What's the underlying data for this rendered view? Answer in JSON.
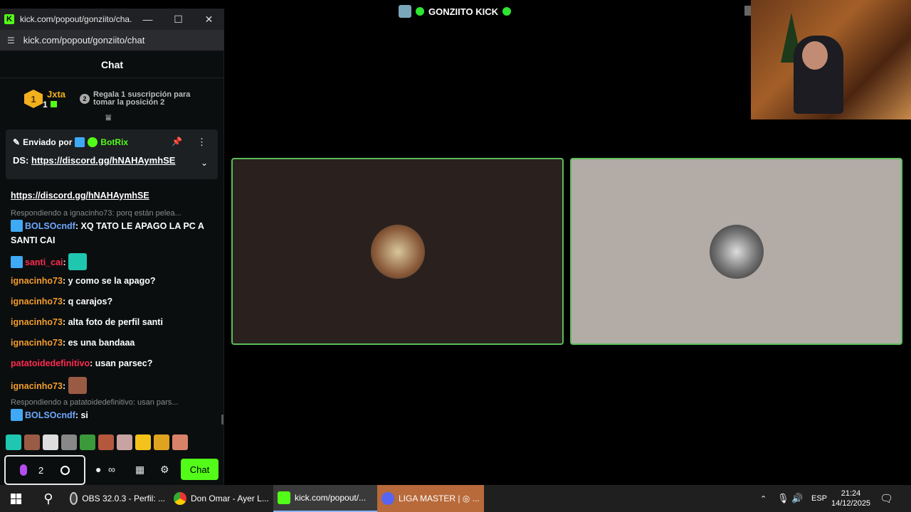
{
  "window": {
    "title": "kick.com/popout/gonziito/cha...",
    "minimize": "—",
    "maximize": "☐",
    "close": "✕",
    "url": "kick.com/popout/gonziito/chat"
  },
  "chat": {
    "header": "Chat",
    "leaderboard": {
      "rank": "1",
      "name": "Jxta",
      "count": "1",
      "next_rank": "2",
      "text_line1": "Regala 1 suscripción para",
      "text_line2": "tomar la posición 2"
    },
    "pinned": {
      "sent_by_label": "Enviado por",
      "bot_name": "BotRix",
      "message_prefix": "DS:",
      "link": "https://discord.gg/hNAHAymhSE"
    },
    "messages": [
      {
        "type": "link",
        "text": "https://discord.gg/hNAHAymhSE"
      },
      {
        "type": "reply",
        "text": "Respondiendo a ignacinho73: porq están pelea..."
      },
      {
        "type": "msg",
        "user": "BOLSOcndf",
        "text": ": XQ TATO LE APAGO LA PC A SANTI CAI"
      },
      {
        "type": "msg",
        "user": "santi_cai",
        "text": ":"
      },
      {
        "type": "msg",
        "user": "ignacinho73",
        "text": ": y como se la apago?"
      },
      {
        "type": "msg",
        "user": "ignacinho73",
        "text": ": q carajos?"
      },
      {
        "type": "msg",
        "user": "ignacinho73",
        "text": ": alta foto de perfil santi"
      },
      {
        "type": "msg",
        "user": "ignacinho73",
        "text": ": es una bandaaa"
      },
      {
        "type": "msg",
        "user": "patatoidedefinitivo",
        "text": ": usan parsec?"
      },
      {
        "type": "msg",
        "user": "ignacinho73",
        "text": ":"
      },
      {
        "type": "reply",
        "text": "Respondiendo a patatoidedefinitivo: usan pars..."
      },
      {
        "type": "msg",
        "user": "BOLSOcndf",
        "text": ": si"
      }
    ],
    "input": {
      "count": "2",
      "send_label": "Chat"
    }
  },
  "stream": {
    "title": "GONZIITO KICK"
  },
  "taskbar": {
    "apps": [
      {
        "label": "OBS 32.0.3 - Perfil: ..."
      },
      {
        "label": "Don Omar - Ayer L..."
      },
      {
        "label": "kick.com/popout/..."
      },
      {
        "label": "LIGA MASTER | ◎ ..."
      }
    ],
    "language": "ESP",
    "time": "21:24",
    "date": "14/12/2025"
  },
  "colors": {
    "kick_green": "#53fc18",
    "username_orange": "#f39c2c",
    "username_blue": "#6ea8ff",
    "username_red": "#ff2a4f",
    "tile_border": "#5cbd5c"
  }
}
